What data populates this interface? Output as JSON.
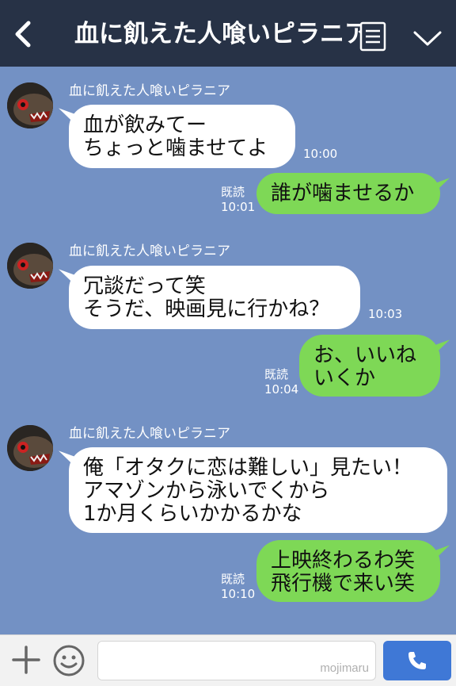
{
  "header": {
    "title": "血に飢えた人喰いピラニア"
  },
  "messages": [
    {
      "sender": "血に飢えた人喰いピラニア",
      "lines": [
        "血が飲みてー",
        "ちょっと噛ませてよ"
      ],
      "time": "10:00"
    },
    {
      "status": "既読",
      "time": "10:01",
      "lines": [
        "誰が噛ませるか"
      ]
    },
    {
      "sender": "血に飢えた人喰いピラニア",
      "lines": [
        "冗談だって笑",
        "そうだ、映画見に行かね？"
      ],
      "time": "10:03"
    },
    {
      "status": "既読",
      "time": "10:04",
      "lines": [
        "お、いいね",
        "いくか"
      ]
    },
    {
      "sender": "血に飢えた人喰いピラニア",
      "lines": [
        "俺「オタクに恋は難しい」見たい！",
        "アマゾンから泳いでくから",
        "1か月くらいかかるかな"
      ]
    },
    {
      "status": "既読",
      "time": "10:10",
      "lines": [
        "上映終わるわ笑",
        "飛行機で来い笑"
      ]
    }
  ],
  "footer": {
    "watermark": "mojimaru"
  },
  "icons": {
    "back": "chevron-left-icon",
    "note": "note-icon",
    "menu": "chevron-down-icon",
    "add": "plus-icon",
    "emoji": "smiley-icon",
    "call": "phone-icon"
  },
  "colors": {
    "header_bg": "#273246",
    "chat_bg": "#7391c4",
    "bubble_in": "#ffffff",
    "bubble_out": "#7ed856",
    "call_button": "#3f78d6"
  }
}
